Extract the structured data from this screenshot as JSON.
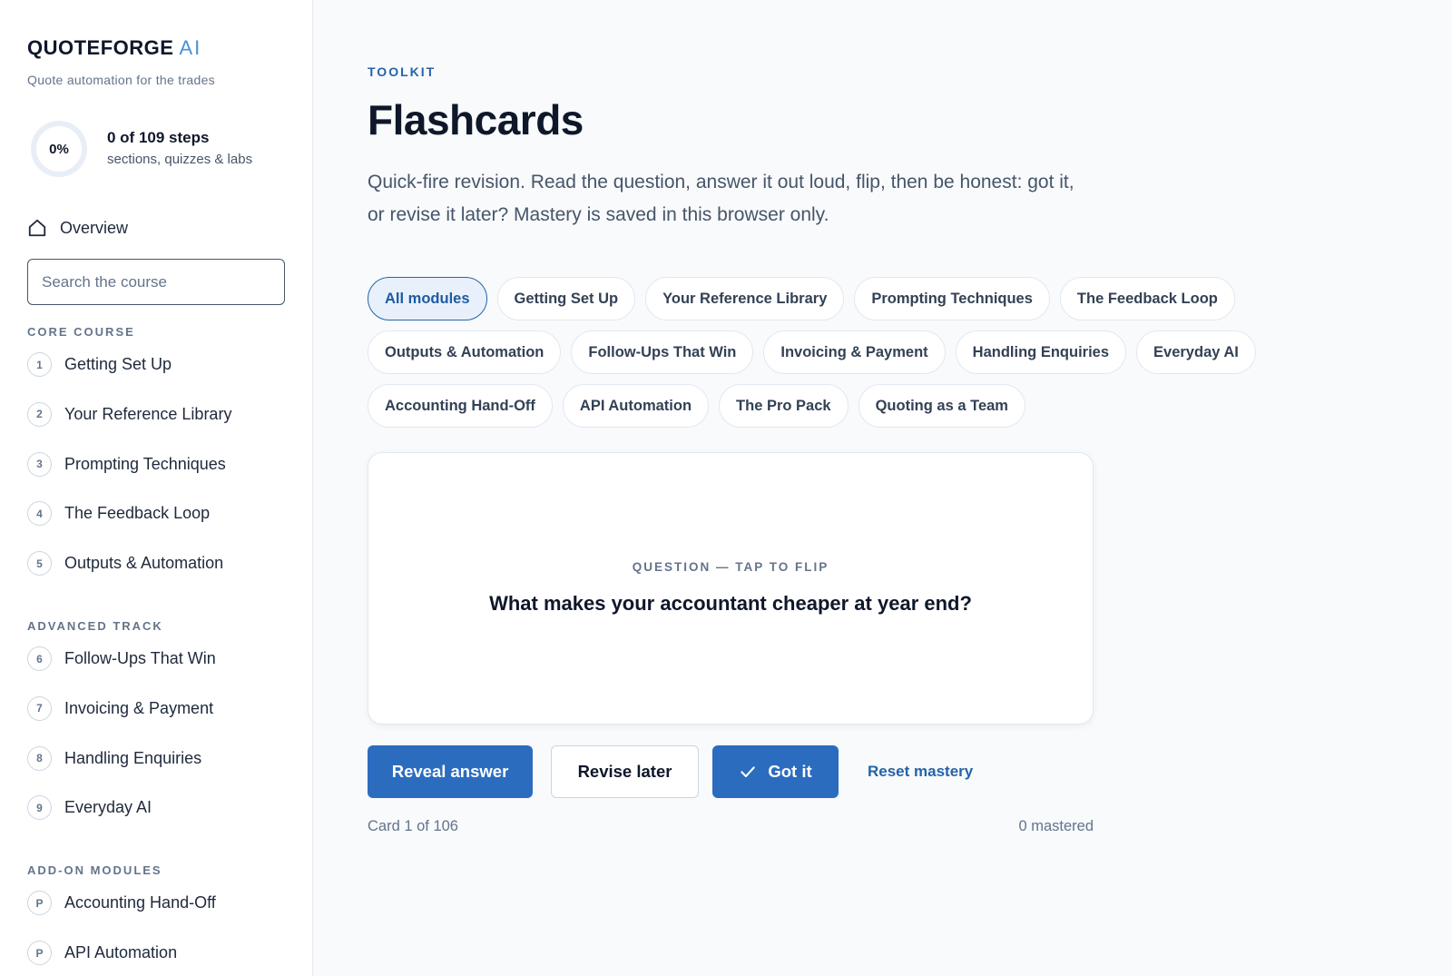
{
  "sidebar": {
    "brand": "QUOTEFORGE",
    "brand_suffix": "AI",
    "tagline": "Quote automation for the trades",
    "progress": {
      "percent_label": "0%",
      "percent_value": 0,
      "steps": "0 of 109 steps",
      "sub": "sections, quizzes & labs"
    },
    "overview_label": "Overview",
    "search_placeholder": "Search the course",
    "sections": [
      {
        "label": "CORE COURSE",
        "items": [
          {
            "num": "1",
            "label": "Getting Set Up"
          },
          {
            "num": "2",
            "label": "Your Reference Library"
          },
          {
            "num": "3",
            "label": "Prompting Techniques"
          },
          {
            "num": "4",
            "label": "The Feedback Loop"
          },
          {
            "num": "5",
            "label": "Outputs & Automation"
          }
        ]
      },
      {
        "label": "ADVANCED TRACK",
        "items": [
          {
            "num": "6",
            "label": "Follow-Ups That Win"
          },
          {
            "num": "7",
            "label": "Invoicing & Payment"
          },
          {
            "num": "8",
            "label": "Handling Enquiries"
          },
          {
            "num": "9",
            "label": "Everyday AI"
          }
        ]
      },
      {
        "label": "ADD-ON MODULES",
        "items": [
          {
            "num": "P",
            "label": "Accounting Hand-Off"
          },
          {
            "num": "P",
            "label": "API Automation"
          }
        ]
      }
    ]
  },
  "main": {
    "eyebrow": "TOOLKIT",
    "title": "Flashcards",
    "description": "Quick-fire revision. Read the question, answer it out loud, flip, then be honest: got it, or revise it later? Mastery is saved in this browser only.",
    "filters": [
      "All modules",
      "Getting Set Up",
      "Your Reference Library",
      "Prompting Techniques",
      "The Feedback Loop",
      "Outputs & Automation",
      "Follow-Ups That Win",
      "Invoicing & Payment",
      "Handling Enquiries",
      "Everyday AI",
      "Accounting Hand-Off",
      "API Automation",
      "The Pro Pack",
      "Quoting as a Team"
    ],
    "active_filter": "All modules",
    "card": {
      "label": "QUESTION — TAP TO FLIP",
      "question": "What makes your accountant cheaper at year end?"
    },
    "actions": {
      "reveal": "Reveal answer",
      "revise": "Revise later",
      "got_it": "Got it",
      "reset": "Reset mastery"
    },
    "counter": "Card 1 of 106",
    "mastered": "0 mastered"
  },
  "colors": {
    "accent": "#2b6cbf",
    "accent_light": "#4a90d9",
    "chip_active_bg": "#e8f1fb",
    "text_muted": "#64748b"
  }
}
